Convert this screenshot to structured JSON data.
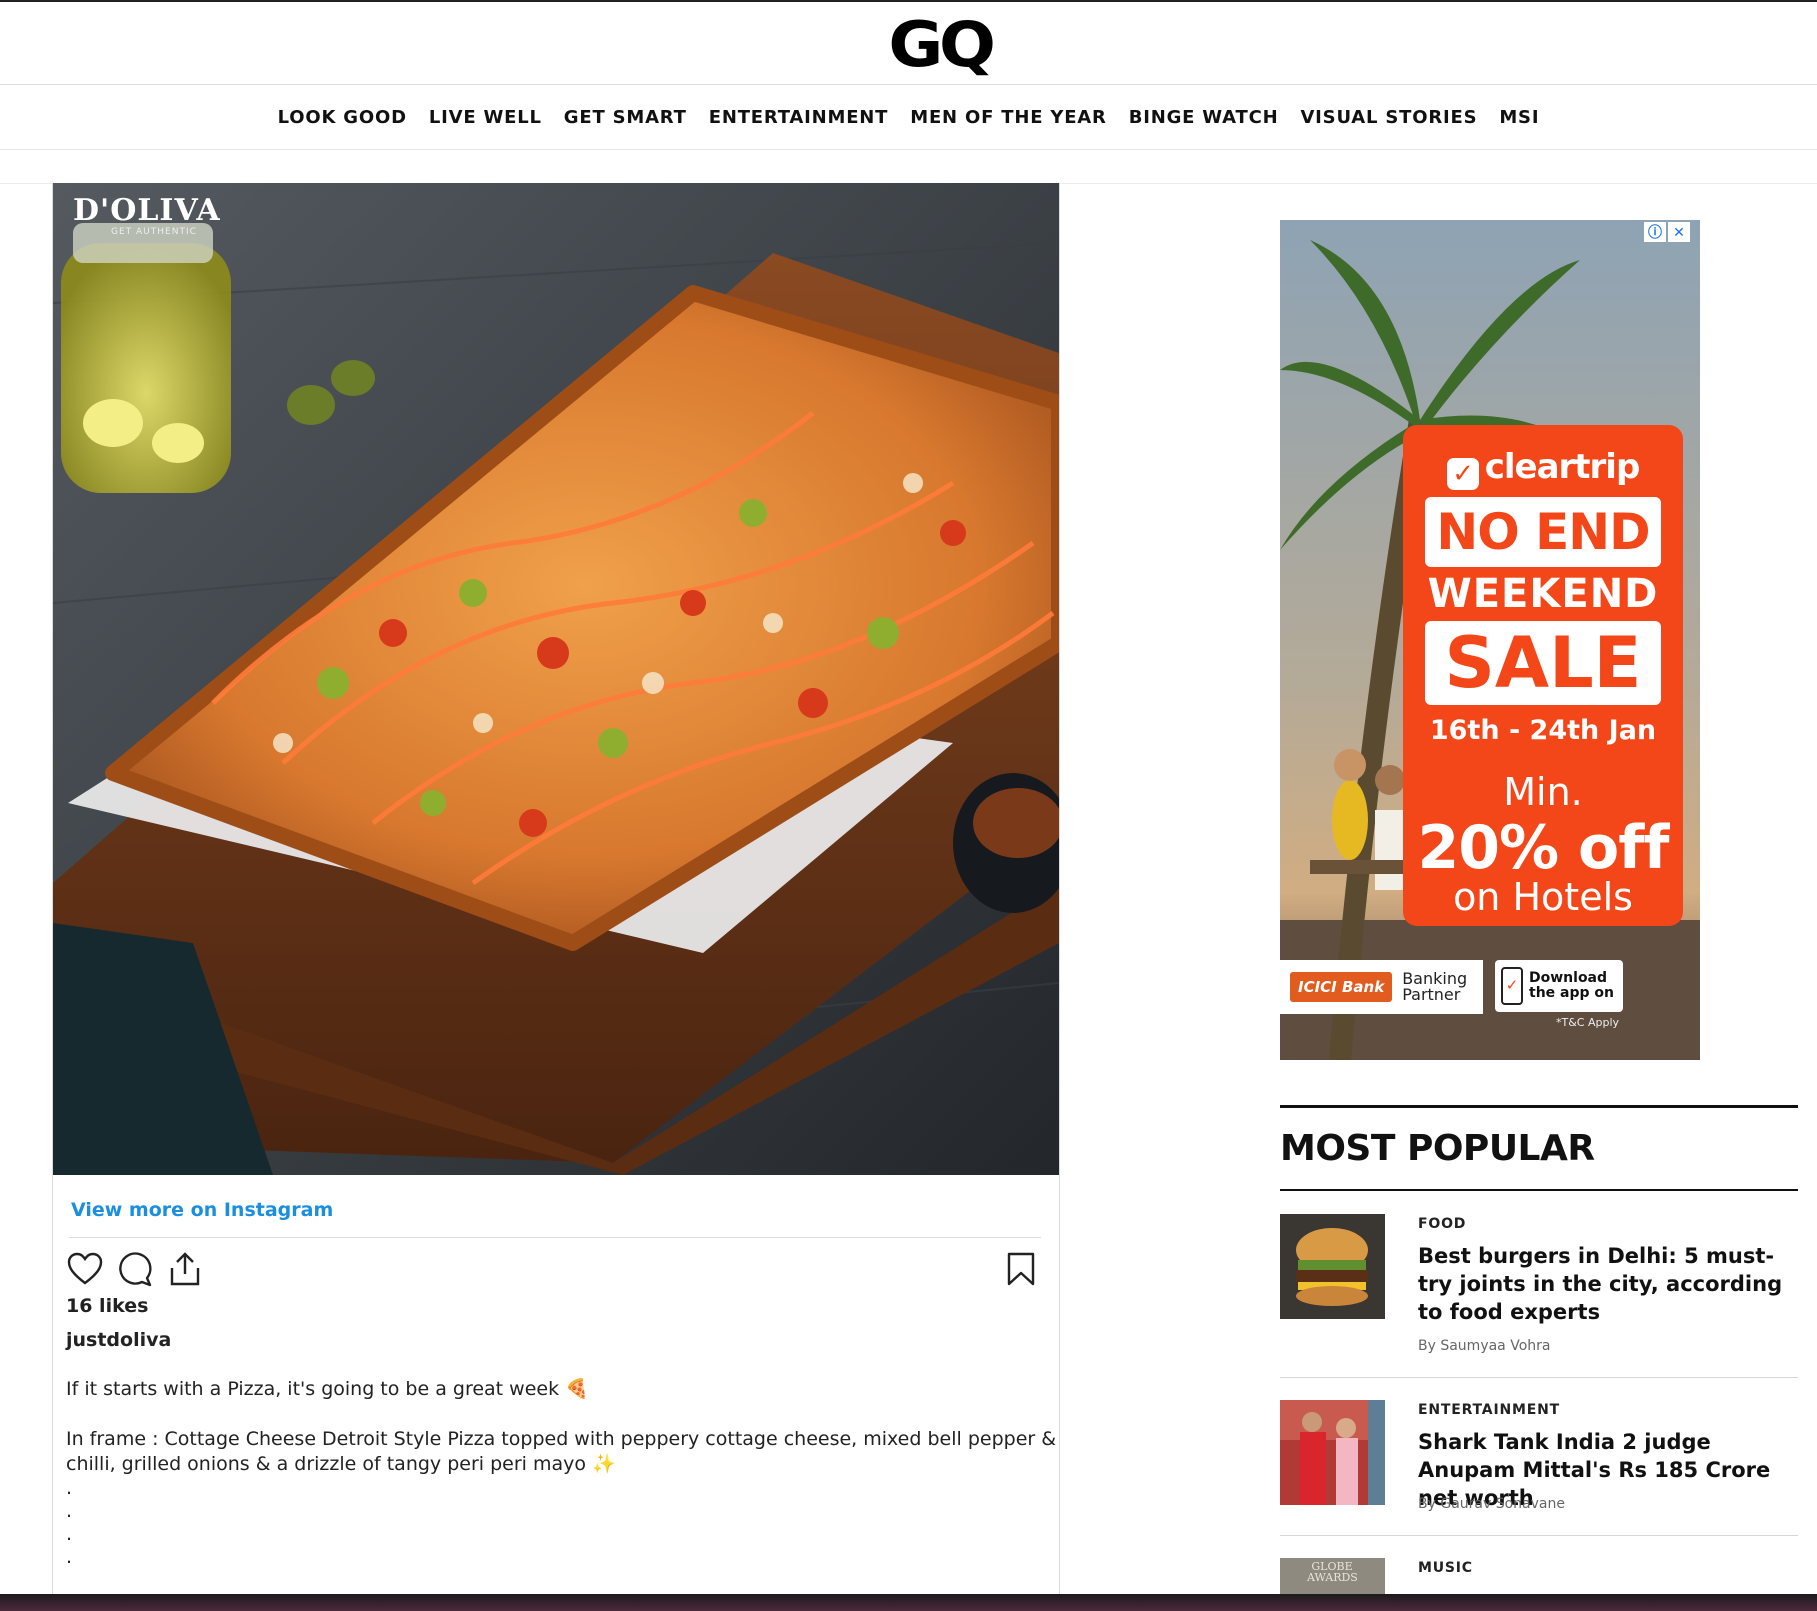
{
  "header": {
    "logo_text": "GQ",
    "nav": [
      "LOOK GOOD",
      "LIVE WELL",
      "GET SMART",
      "ENTERTAINMENT",
      "MEN OF THE YEAR",
      "BINGE WATCH",
      "VISUAL STORIES",
      "MSI"
    ]
  },
  "instagram": {
    "image_brand": "D'OLIVA",
    "image_tagline": "GET AUTHENTIC",
    "view_more": "View more on Instagram",
    "likes": "16 likes",
    "username": "justdoliva",
    "caption_line1": "If it starts with a Pizza, it's going to be a great week 🍕",
    "caption_line2": "In frame : Cottage Cheese Detroit Style Pizza topped with peppery cottage cheese, mixed bell pepper & chilli, grilled onions & a drizzle of tangy peri peri mayo ✨",
    "caption_dots": ".\n.\n.\n.",
    "icons": [
      "heart-icon",
      "comment-icon",
      "share-icon",
      "bookmark-icon"
    ]
  },
  "ad": {
    "controls": [
      "ⓘ",
      "✕"
    ],
    "brand": "cleartrip",
    "line1": "NO END",
    "line2": "WEEKEND",
    "line3": "SALE",
    "dates": "16th - 24th Jan",
    "min": "Min.",
    "percent": "20% off",
    "on": "on Hotels",
    "bank": "ICICI Bank",
    "bank_role": "Banking Partner",
    "download": "Download the app on",
    "tc": "*T&C Apply",
    "colors": {
      "accent": "#f44719"
    }
  },
  "most_popular": {
    "heading": "MOST POPULAR",
    "items": [
      {
        "category": "FOOD",
        "title": "Best burgers in Delhi: 5 must-try joints in the city, according to food experts",
        "author": "By Saumyaa Vohra"
      },
      {
        "category": "ENTERTAINMENT",
        "title": "Shark Tank India 2 judge Anupam Mittal's Rs 185 Crore net worth",
        "author": "By Gaurav Sonavane"
      },
      {
        "category": "MUSIC",
        "thumb_text": "GLOBE AWARDS"
      }
    ]
  }
}
